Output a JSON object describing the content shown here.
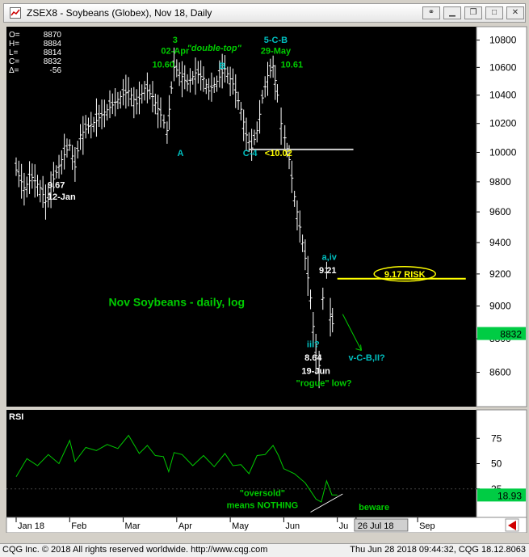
{
  "window": {
    "title": "ZSEX8 - Soybeans (Globex), Nov 18, Daily",
    "icon": "cqg-chart-icon"
  },
  "footer": {
    "left": "CQG Inc. © 2018 All rights reserved worldwide.  http://www.cqg.com",
    "right": "Thu Jun 28 2018 09:44:32, CQG 18.12.8063"
  },
  "colors": {
    "background": "#000000",
    "candles": "#ffffff",
    "annotation_green": "#00cc00",
    "annotation_cyan": "#00c0c0",
    "annotation_white": "#ffffff",
    "risk_yellow": "#ffff00",
    "last_price_box": "#00cc44",
    "rsi_line": "#00cc00"
  },
  "chart_data": [
    {
      "type": "candlestick",
      "title": "Nov Soybeans - daily, log",
      "ohlc_readout": {
        "O": "8870",
        "H": "8884",
        "L": "8814",
        "C": "8832",
        "delta": "-56"
      },
      "ohlc_labels": [
        "O=",
        "H=",
        "L=",
        "C=",
        "Δ="
      ],
      "y_scale": "log",
      "ylim": [
        8400,
        10900
      ],
      "y_ticks": [
        "10800",
        "10600",
        "10400",
        "10200",
        "10000",
        "9800",
        "9600",
        "9400",
        "9200",
        "9000",
        "8800",
        "8600"
      ],
      "last_price": "8832",
      "x_labels": [
        "Jan 18",
        "Feb",
        "Mar",
        "Apr",
        "May",
        "Jun",
        "Ju",
        "26 Jul 18",
        "Sep"
      ],
      "x_label_positions": [
        0.0,
        1.0,
        2.0,
        3.0,
        4.0,
        5.0,
        6.0,
        6.35,
        7.5
      ],
      "close_path": [
        [
          0.0,
          9880
        ],
        [
          0.15,
          9760
        ],
        [
          0.3,
          9830
        ],
        [
          0.45,
          9760
        ],
        [
          0.55,
          9670
        ],
        [
          0.7,
          9820
        ],
        [
          0.85,
          9950
        ],
        [
          1.0,
          10050
        ],
        [
          1.1,
          9900
        ],
        [
          1.2,
          10120
        ],
        [
          1.35,
          10180
        ],
        [
          1.5,
          10220
        ],
        [
          1.65,
          10280
        ],
        [
          1.8,
          10330
        ],
        [
          1.95,
          10390
        ],
        [
          2.1,
          10430
        ],
        [
          2.25,
          10340
        ],
        [
          2.4,
          10450
        ],
        [
          2.55,
          10390
        ],
        [
          2.7,
          10260
        ],
        [
          2.82,
          10150
        ],
        [
          2.9,
          10450
        ],
        [
          2.95,
          10600
        ],
        [
          3.05,
          10560
        ],
        [
          3.2,
          10480
        ],
        [
          3.35,
          10560
        ],
        [
          3.5,
          10520
        ],
        [
          3.6,
          10430
        ],
        [
          3.75,
          10500
        ],
        [
          3.9,
          10590
        ],
        [
          4.05,
          10480
        ],
        [
          4.2,
          10300
        ],
        [
          4.3,
          10120
        ],
        [
          4.4,
          10030
        ],
        [
          4.5,
          10150
        ],
        [
          4.6,
          10380
        ],
        [
          4.7,
          10540
        ],
        [
          4.8,
          10610
        ],
        [
          4.88,
          10400
        ],
        [
          4.95,
          10200
        ],
        [
          5.02,
          10100
        ],
        [
          5.1,
          9950
        ],
        [
          5.2,
          9700
        ],
        [
          5.3,
          9500
        ],
        [
          5.4,
          9300
        ],
        [
          5.5,
          9050
        ],
        [
          5.6,
          8700
        ],
        [
          5.66,
          8640
        ],
        [
          5.73,
          9050
        ],
        [
          5.8,
          9210
        ],
        [
          5.87,
          8950
        ],
        [
          5.95,
          8832
        ]
      ],
      "annotations": [
        {
          "text": "3",
          "x": 2.97,
          "y": 10780,
          "color": "annotation_green"
        },
        {
          "text": "02-Apr",
          "x": 2.97,
          "y": 10700,
          "color": "annotation_green"
        },
        {
          "text": "10.60",
          "x": 2.75,
          "y": 10600,
          "color": "annotation_green"
        },
        {
          "text": "\"double-top\"",
          "x": 3.7,
          "y": 10720,
          "color": "annotation_green",
          "italic": true
        },
        {
          "text": "5-C-B",
          "x": 4.85,
          "y": 10780,
          "color": "annotation_cyan"
        },
        {
          "text": "29-May",
          "x": 4.85,
          "y": 10700,
          "color": "annotation_green"
        },
        {
          "text": "10.61",
          "x": 5.15,
          "y": 10600,
          "color": "annotation_green"
        },
        {
          "text": "B",
          "x": 3.85,
          "y": 10590,
          "color": "annotation_cyan"
        },
        {
          "text": "A",
          "x": 3.07,
          "y": 9975,
          "color": "annotation_cyan"
        },
        {
          "text": "C-4",
          "x": 4.37,
          "y": 9975,
          "color": "annotation_cyan"
        },
        {
          "text": "<10.02",
          "x": 4.9,
          "y": 9975,
          "color": "risk_yellow"
        },
        {
          "text": "9.67",
          "x": 0.75,
          "y": 9760,
          "color": "annotation_white"
        },
        {
          "text": "12-Jan",
          "x": 0.85,
          "y": 9680,
          "color": "annotation_white"
        },
        {
          "text": "a,iv",
          "x": 5.85,
          "y": 9290,
          "color": "annotation_cyan"
        },
        {
          "text": "9.21",
          "x": 5.82,
          "y": 9205,
          "color": "annotation_white"
        },
        {
          "text": "9.17 RISK",
          "x": 7.2,
          "y": 9180,
          "color": "risk_yellow"
        },
        {
          "text": "Nov Soybeans - daily, log",
          "x": 3.0,
          "y": 9000,
          "color": "annotation_green"
        },
        {
          "text": "iii?",
          "x": 5.55,
          "y": 8750,
          "color": "annotation_cyan"
        },
        {
          "text": "8.64",
          "x": 5.55,
          "y": 8670,
          "color": "annotation_white"
        },
        {
          "text": "19-Jun",
          "x": 5.6,
          "y": 8590,
          "color": "annotation_white"
        },
        {
          "text": "\"rogue\" low?",
          "x": 5.75,
          "y": 8520,
          "color": "annotation_green"
        },
        {
          "text": "v-C-B,II?",
          "x": 6.55,
          "y": 8670,
          "color": "annotation_cyan"
        }
      ],
      "lines": [
        {
          "from": [
            4.35,
            10020
          ],
          "to": [
            6.3,
            10020
          ],
          "color": "#cfcfcf"
        },
        {
          "from": [
            6.0,
            9170
          ],
          "to": [
            8.4,
            9170
          ],
          "color": "risk_yellow"
        }
      ],
      "arrow": {
        "from": [
          6.1,
          8950
        ],
        "to": [
          6.45,
          8730
        ],
        "color": "annotation_green"
      },
      "legend": "none",
      "grid": false
    },
    {
      "type": "line",
      "title": "RSI",
      "ylim": [
        0,
        100
      ],
      "y_ticks": [
        "75",
        "50",
        "25"
      ],
      "last_value": "18.93",
      "series": [
        {
          "values": [
            [
              0.0,
              40
            ],
            [
              0.2,
              55
            ],
            [
              0.4,
              45
            ],
            [
              0.6,
              62
            ],
            [
              0.8,
              50
            ],
            [
              1.0,
              70
            ],
            [
              1.1,
              55
            ],
            [
              1.3,
              66
            ],
            [
              1.5,
              60
            ],
            [
              1.7,
              72
            ],
            [
              1.9,
              65
            ],
            [
              2.1,
              75
            ],
            [
              2.3,
              63
            ],
            [
              2.45,
              68
            ],
            [
              2.6,
              55
            ],
            [
              2.75,
              60
            ],
            [
              2.85,
              42
            ],
            [
              2.95,
              58
            ],
            [
              3.1,
              62
            ],
            [
              3.3,
              48
            ],
            [
              3.5,
              55
            ],
            [
              3.7,
              50
            ],
            [
              3.9,
              60
            ],
            [
              4.05,
              45
            ],
            [
              4.2,
              52
            ],
            [
              4.35,
              40
            ],
            [
              4.5,
              55
            ],
            [
              4.65,
              62
            ],
            [
              4.8,
              68
            ],
            [
              4.9,
              55
            ],
            [
              5.0,
              48
            ],
            [
              5.2,
              40
            ],
            [
              5.4,
              28
            ],
            [
              5.6,
              18
            ],
            [
              5.7,
              12
            ],
            [
              5.8,
              30
            ],
            [
              5.9,
              22
            ],
            [
              6.0,
              18.93
            ]
          ]
        }
      ],
      "annotations": [
        {
          "text": "\"oversold\"",
          "x": 4.6,
          "y": 18,
          "color": "annotation_green"
        },
        {
          "text": "means NOTHING",
          "x": 4.6,
          "y": 6,
          "color": "annotation_green"
        },
        {
          "text": "beware",
          "x": 6.4,
          "y": 4,
          "color": "annotation_green"
        }
      ],
      "trend_line": {
        "from": [
          5.5,
          2
        ],
        "to": [
          6.1,
          20
        ],
        "color": "#ffffff"
      }
    }
  ]
}
